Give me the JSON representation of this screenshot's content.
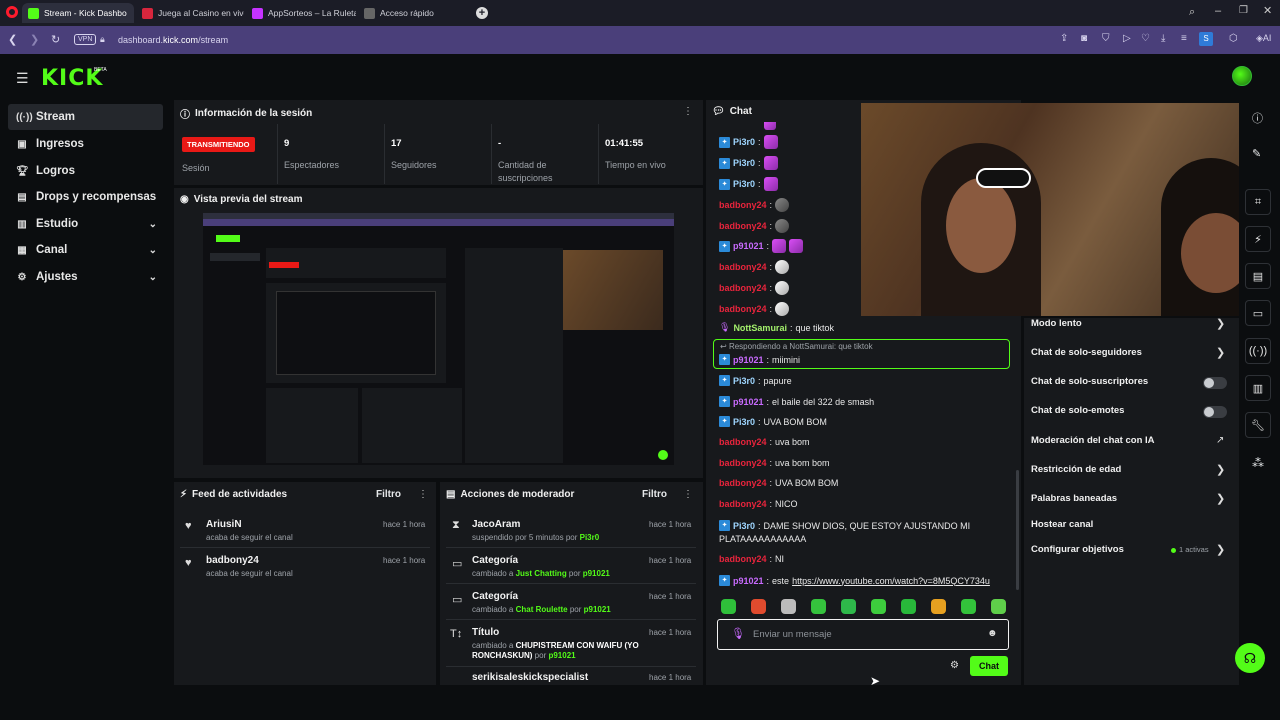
{
  "browser": {
    "tabs": [
      {
        "label": "Stream - Kick Dashbo",
        "color": "#53fc18"
      },
      {
        "label": "Juega al Casino en vivo O",
        "color": "#d7263d"
      },
      {
        "label": "AppSorteos – La Ruleta de",
        "color": "#c633ff"
      },
      {
        "label": "Acceso rápido",
        "color": "#888888"
      }
    ],
    "vpn": "VPN",
    "url_prefix": "dashboard.",
    "url_domain": "kick.com",
    "url_path": "/stream",
    "profile_initial": "S",
    "ai_label": "AI"
  },
  "app": {
    "logo": "KICK",
    "beta": "BETA"
  },
  "sidebar": {
    "items": [
      {
        "label": "Stream",
        "icon": "broadcast-icon"
      },
      {
        "label": "Ingresos",
        "icon": "wallet-icon"
      },
      {
        "label": "Logros",
        "icon": "trophy-icon"
      },
      {
        "label": "Drops y recompensas",
        "icon": "gift-icon"
      },
      {
        "label": "Estudio",
        "icon": "studio-icon"
      },
      {
        "label": "Canal",
        "icon": "channel-icon"
      },
      {
        "label": "Ajustes",
        "icon": "gear-icon"
      }
    ]
  },
  "session": {
    "title": "Información de la sesión",
    "live_badge": "TRANSMITIENDO",
    "status_label": "Sesión",
    "stats": [
      {
        "value": "9",
        "label": "Espectadores"
      },
      {
        "value": "17",
        "label": "Seguidores"
      },
      {
        "value": "-",
        "label": "Cantidad de suscripciones"
      },
      {
        "value": "01:41:55",
        "label": "Tiempo en vivo"
      }
    ]
  },
  "preview": {
    "title": "Vista previa del stream"
  },
  "activity": {
    "title": "Feed de actividades",
    "filter": "Filtro",
    "items": [
      {
        "user": "AriusiN",
        "text": "acaba de seguir el canal",
        "time": "hace 1 hora"
      },
      {
        "user": "badbony24",
        "text": "acaba de seguir el canal",
        "time": "hace 1 hora"
      }
    ]
  },
  "mod": {
    "title": "Acciones de moderador",
    "filter": "Filtro",
    "items": [
      {
        "title": "JacoAram",
        "pre": "suspendido por 5 minutos por ",
        "hl": "",
        "mid": "",
        "by": "Pi3r0",
        "time": "hace 1 hora",
        "icon": "hourglass-icon"
      },
      {
        "title": "Categoría",
        "pre": "cambiado a ",
        "hl": "Just Chatting",
        "mid": " por ",
        "by": "p91021",
        "time": "hace 1 hora",
        "icon": "category-icon"
      },
      {
        "title": "Categoría",
        "pre": "cambiado a ",
        "hl": "Chat Roulette",
        "mid": " por ",
        "by": "p91021",
        "time": "hace 1 hora",
        "icon": "category-icon"
      },
      {
        "title": "Título",
        "pre": "cambiado a ",
        "hl": "CHUPISTREAM CON WAIFU (YO RONCHASKUN)",
        "mid": " por ",
        "by": "p91021",
        "time": "hace 1 hora",
        "icon": "title-icon"
      },
      {
        "title": "serikisaleskickspecialist",
        "pre": "",
        "hl": "",
        "mid": "",
        "by": "",
        "time": "hace 1 hora",
        "icon": "user-icon"
      }
    ]
  },
  "chat": {
    "title": "Chat",
    "messages": [
      {
        "user": "Pi3r0",
        "cls": "u-pi",
        "badge": true,
        "text": "",
        "emotes": [
          "pink"
        ]
      },
      {
        "user": "Pi3r0",
        "cls": "u-pi",
        "badge": true,
        "text": "",
        "emotes": [
          "pink"
        ]
      },
      {
        "user": "Pi3r0",
        "cls": "u-pi",
        "badge": true,
        "text": "",
        "emotes": [
          "pink"
        ]
      },
      {
        "user": "badbony24",
        "cls": "u-bad",
        "badge": false,
        "text": "",
        "emotes": [
          "rock"
        ]
      },
      {
        "user": "badbony24",
        "cls": "u-bad",
        "badge": false,
        "text": "",
        "emotes": [
          "rock"
        ]
      },
      {
        "user": "p91021",
        "cls": "u-p9",
        "badge": true,
        "text": "",
        "emotes": [
          "pink",
          "pink"
        ]
      },
      {
        "user": "badbony24",
        "cls": "u-bad",
        "badge": false,
        "text": "",
        "emotes": [
          "duck"
        ]
      },
      {
        "user": "badbony24",
        "cls": "u-bad",
        "badge": false,
        "text": "",
        "emotes": [
          "duck"
        ]
      },
      {
        "user": "badbony24",
        "cls": "u-bad",
        "badge": false,
        "text": "",
        "emotes": [
          "duck"
        ]
      },
      {
        "user": "NottSamurai",
        "cls": "u-nott",
        "badge": false,
        "text": "que tiktok",
        "emotes": []
      }
    ],
    "reply_context": "Respondiendo a NottSamurai: que tiktok",
    "reply_user": "p91021",
    "reply_text": "miimini",
    "messages2": [
      {
        "user": "Pi3r0",
        "cls": "u-pi",
        "badge": true,
        "text": "papure"
      },
      {
        "user": "p91021",
        "cls": "u-p9",
        "badge": true,
        "text": "el baile del 322 de smash"
      },
      {
        "user": "Pi3r0",
        "cls": "u-pi",
        "badge": true,
        "text": "UVA BOM BOM"
      },
      {
        "user": "badbony24",
        "cls": "u-bad",
        "badge": false,
        "text": "uva bom"
      },
      {
        "user": "badbony24",
        "cls": "u-bad",
        "badge": false,
        "text": "uva bom bom"
      },
      {
        "user": "badbony24",
        "cls": "u-bad",
        "badge": false,
        "text": "UVA BOM BOM"
      },
      {
        "user": "badbony24",
        "cls": "u-bad",
        "badge": false,
        "text": "NICO"
      }
    ],
    "long_msg_user": "Pi3r0",
    "long_msg_line1": "DAME SHOW DIOS, QUE ESTOY AJUSTANDO MI",
    "long_msg_line2": "PLATAAAAAAAAAAA",
    "msg_ni_user": "badbony24",
    "msg_ni_text": "NI",
    "msg_link_user": "p91021",
    "msg_link_pre": "este ",
    "msg_link": "https://www.youtube.com/watch?v=8M5QCY734u",
    "input_placeholder": "Enviar un mensaje",
    "send_label": "Chat",
    "emote_colors": [
      "#2fbf3a",
      "#e04b2e",
      "#bbbbbb",
      "#35c23d",
      "#2eb84a",
      "#3dcc3d",
      "#28b83a",
      "#e6a020",
      "#33c23b",
      "#5fcf4a"
    ]
  },
  "chat_settings": {
    "items": [
      {
        "label": "Modo lento",
        "kind": "chevron"
      },
      {
        "label": "Chat de solo-seguidores",
        "kind": "chevron"
      },
      {
        "label": "Chat de solo-suscriptores",
        "kind": "toggle"
      },
      {
        "label": "Chat de solo-emotes",
        "kind": "toggle"
      },
      {
        "label": "Moderación del chat con IA",
        "kind": "external"
      },
      {
        "label": "Restricción de edad",
        "kind": "chevron"
      },
      {
        "label": "Palabras baneadas",
        "kind": "chevron"
      },
      {
        "label": "Hostear canal",
        "kind": "none"
      },
      {
        "label": "Configurar objetivos",
        "kind": "chevron"
      }
    ],
    "goals_active": "1 activas"
  },
  "colors": {
    "accent": "#53fc18",
    "live": "#e91916"
  }
}
